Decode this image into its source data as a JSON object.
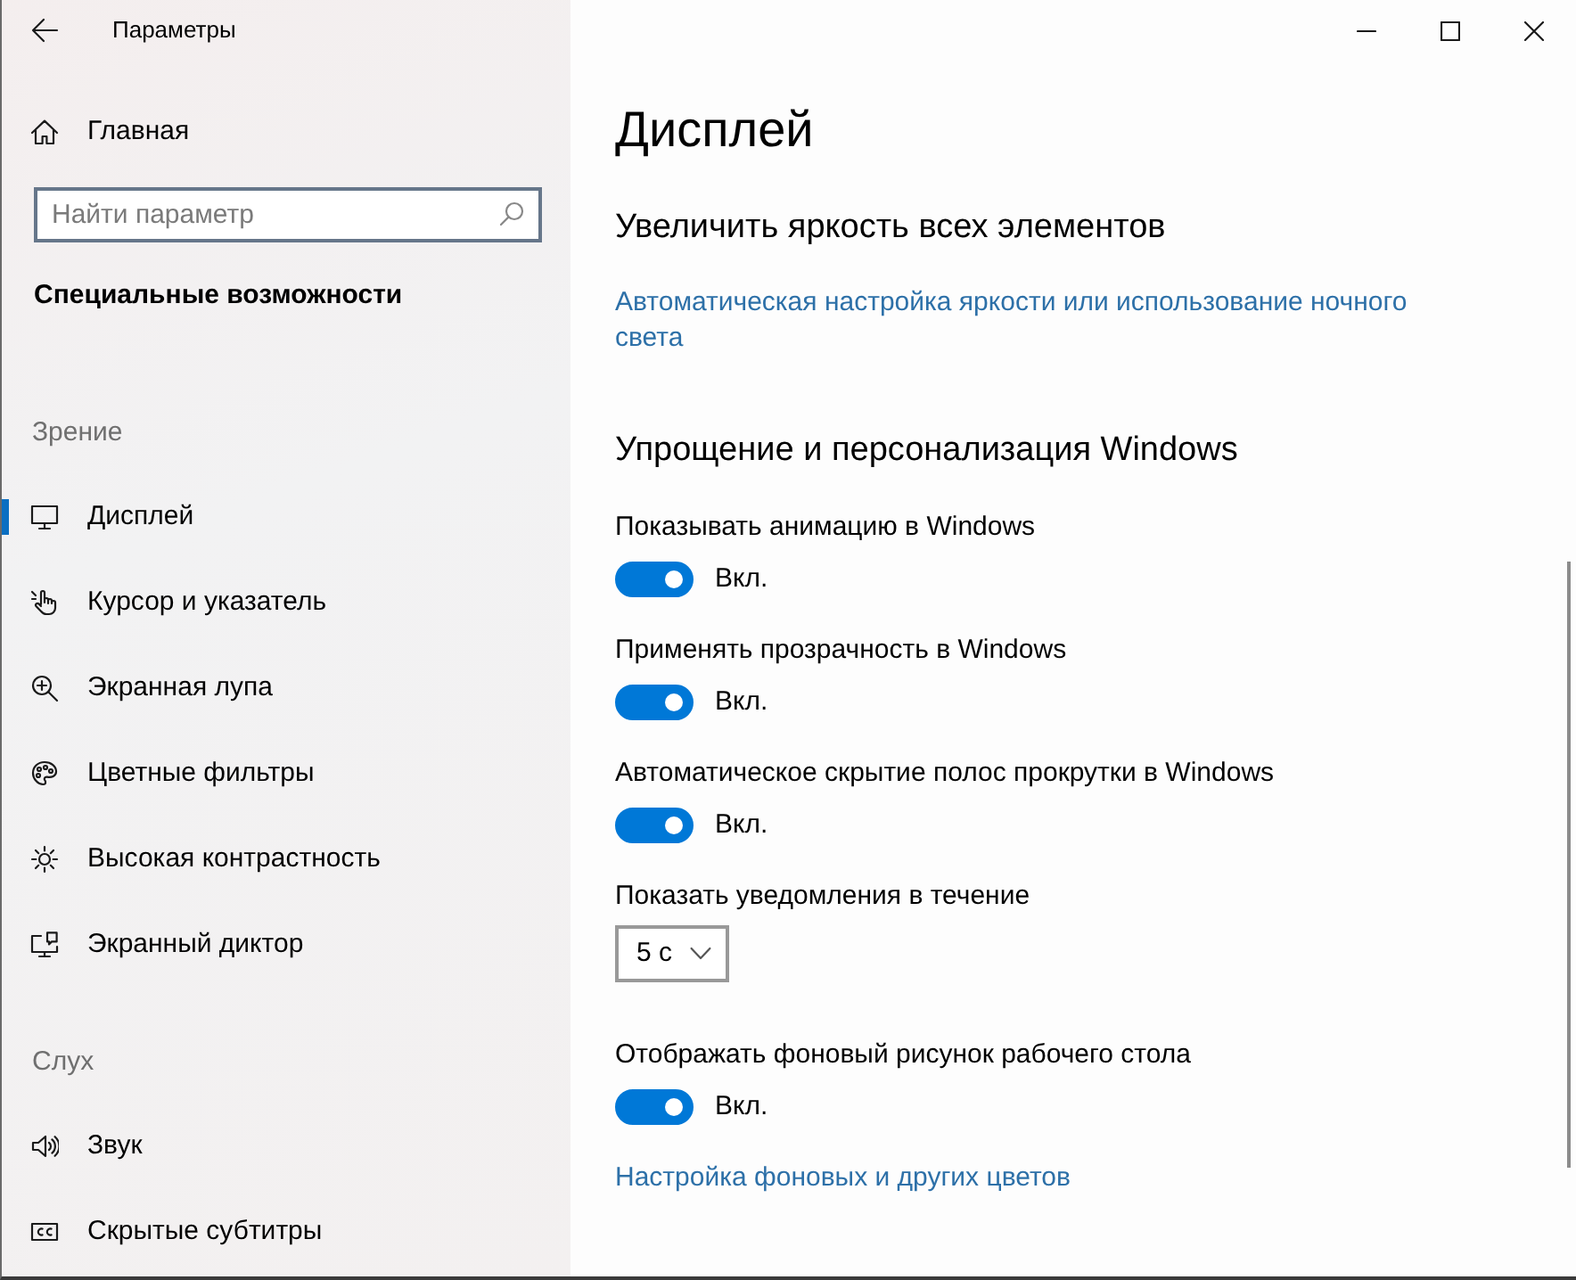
{
  "window": {
    "title": "Параметры"
  },
  "sidebar": {
    "home": "Главная",
    "search": {
      "placeholder": "Найти параметр"
    },
    "category": "Специальные возможности",
    "groups": [
      {
        "heading": "Зрение",
        "items": [
          {
            "label": "Дисплей",
            "selected": true
          },
          {
            "label": "Курсор и указатель",
            "selected": false
          },
          {
            "label": "Экранная лупа",
            "selected": false
          },
          {
            "label": "Цветные фильтры",
            "selected": false
          },
          {
            "label": "Высокая контрастность",
            "selected": false
          },
          {
            "label": "Экранный диктор",
            "selected": false
          }
        ]
      },
      {
        "heading": "Слух",
        "items": [
          {
            "label": "Звук",
            "selected": false
          },
          {
            "label": "Скрытые субтитры",
            "selected": false
          }
        ]
      }
    ]
  },
  "page": {
    "title": "Дисплей",
    "sections": [
      {
        "heading": "Увеличить яркость всех элементов",
        "items": [
          {
            "kind": "link",
            "text": "Автоматическая настройка яркости или использование ночного света"
          }
        ]
      },
      {
        "heading": "Упрощение и персонализация Windows",
        "items": [
          {
            "kind": "toggle",
            "label": "Показывать анимацию в Windows",
            "on": true,
            "state_text": "Вкл."
          },
          {
            "kind": "toggle",
            "label": "Применять прозрачность в Windows",
            "on": true,
            "state_text": "Вкл."
          },
          {
            "kind": "toggle",
            "label": "Автоматическое скрытие полос прокрутки в Windows",
            "on": true,
            "state_text": "Вкл."
          },
          {
            "kind": "dropdown",
            "label": "Показать уведомления в течение",
            "value": "5 с"
          },
          {
            "kind": "toggle",
            "label": "Отображать фоновый рисунок рабочего стола",
            "on": true,
            "state_text": "Вкл."
          },
          {
            "kind": "link",
            "text": "Настройка фоновых и других цветов"
          }
        ]
      }
    ]
  }
}
